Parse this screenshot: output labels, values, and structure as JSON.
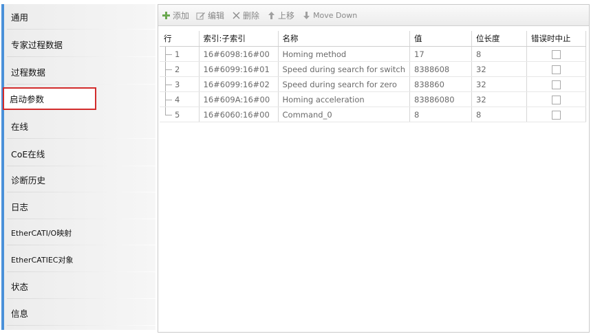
{
  "sidebar": {
    "items": [
      {
        "label": "通用"
      },
      {
        "label": "专家过程数据"
      },
      {
        "label": "过程数据"
      },
      {
        "label": "启动参数"
      },
      {
        "label": "在线"
      },
      {
        "label": "CoE在线"
      },
      {
        "label": "诊断历史"
      },
      {
        "label": "日志"
      },
      {
        "label": "EtherCATI/O映射"
      },
      {
        "label": "EtherCATIEC对象"
      },
      {
        "label": "状态"
      },
      {
        "label": "信息"
      }
    ],
    "active_index": 3
  },
  "toolbar": {
    "add_label": "添加",
    "edit_label": "编辑",
    "delete_label": "删除",
    "move_up_label": "上移",
    "move_down_label": "Move Down"
  },
  "table": {
    "columns": [
      "行",
      "索引:子索引",
      "名称",
      "值",
      "位长度",
      "错误时中止"
    ],
    "rows": [
      {
        "no": "1",
        "index": "16#6098:16#00",
        "name": "Homing method",
        "value": "17",
        "bitlen": "8"
      },
      {
        "no": "2",
        "index": "16#6099:16#01",
        "name": "Speed during search for switch",
        "value": "8388608",
        "bitlen": "32"
      },
      {
        "no": "3",
        "index": "16#6099:16#02",
        "name": "Speed during search for zero",
        "value": "838860",
        "bitlen": "32"
      },
      {
        "no": "4",
        "index": "16#609A:16#00",
        "name": "Homing acceleration",
        "value": "83886080",
        "bitlen": "32"
      },
      {
        "no": "5",
        "index": "16#6060:16#00",
        "name": "Command_0",
        "value": "8",
        "bitlen": "8"
      }
    ]
  }
}
